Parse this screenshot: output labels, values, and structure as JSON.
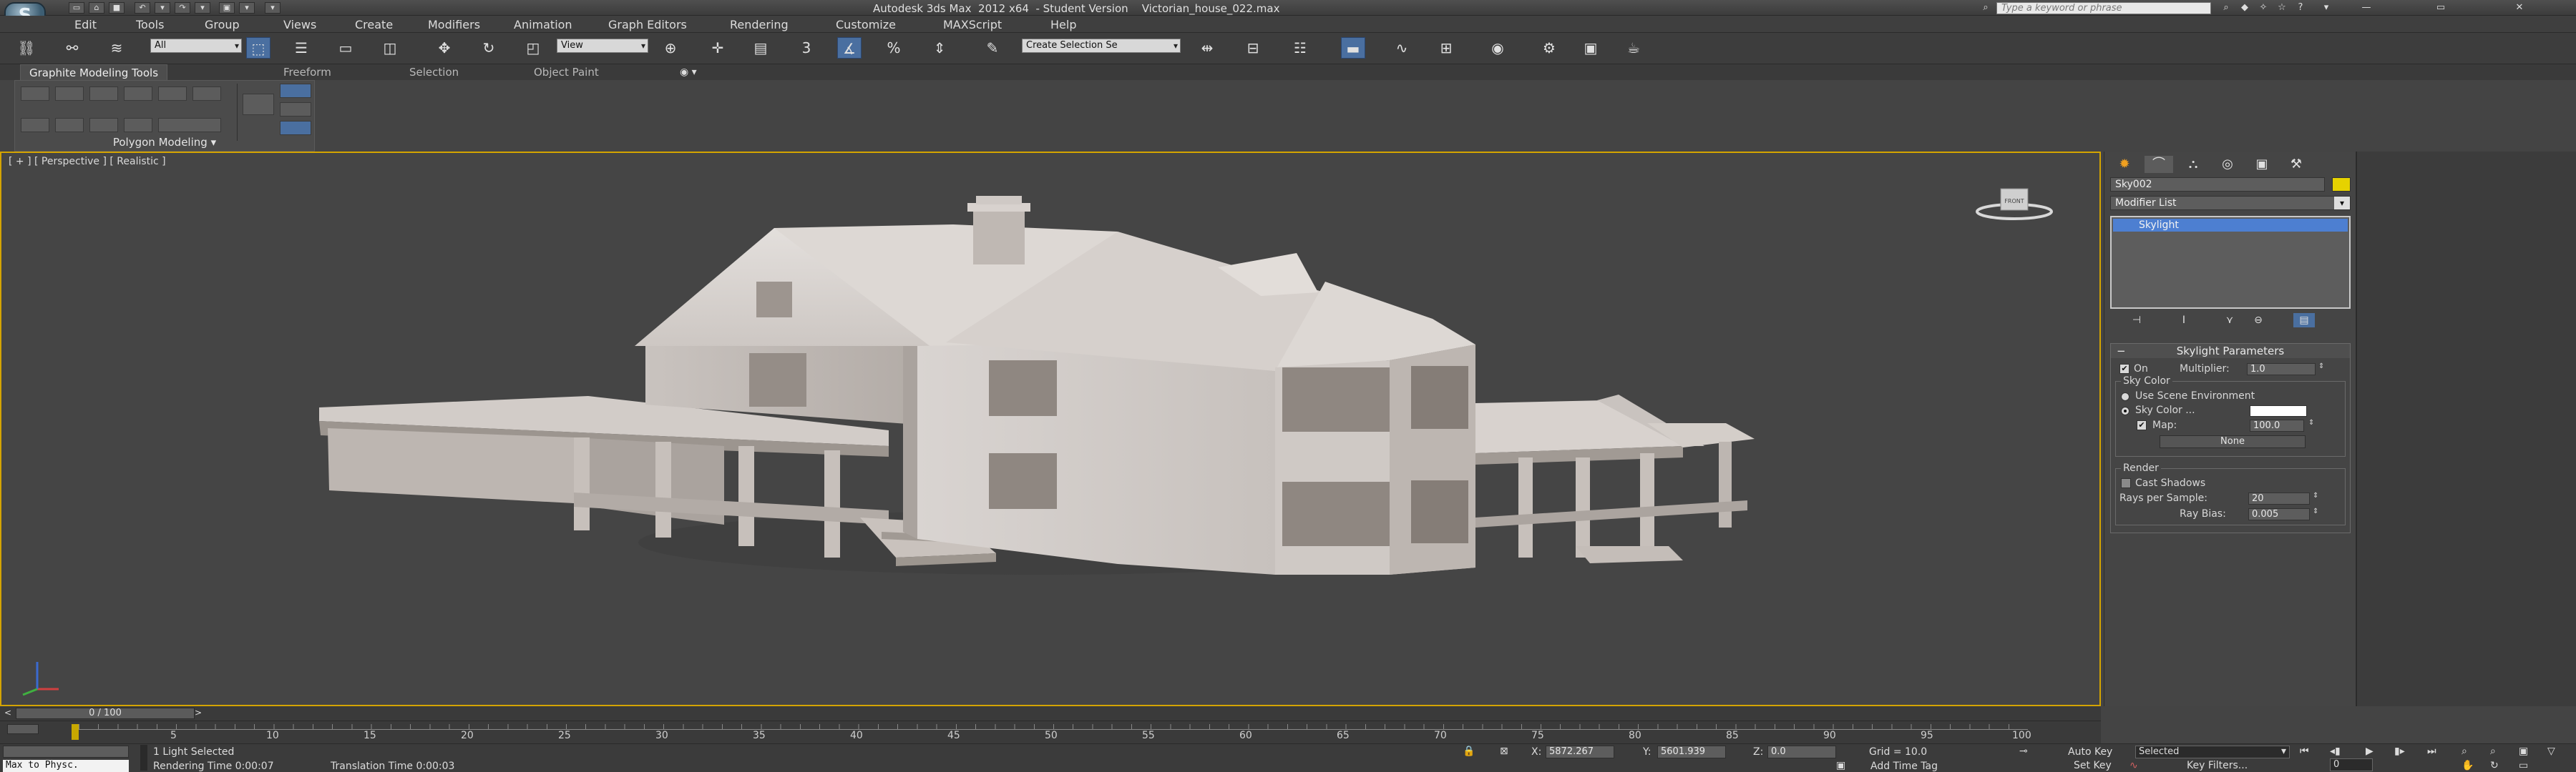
{
  "app": {
    "logo": "S",
    "title": "Autodesk 3ds Max  2012 x64  - Student Version    Victorian_house_022.max",
    "search_placeholder": "Type a keyword or phrase"
  },
  "menu": [
    "Edit",
    "Tools",
    "Group",
    "Views",
    "Create",
    "Modifiers",
    "Animation",
    "Graph Editors",
    "Rendering",
    "Customize",
    "MAXScript",
    "Help"
  ],
  "toolbar": {
    "selection_filter": "All",
    "reference_coord": "View",
    "named_selection": "Create Selection Se"
  },
  "ribbon": {
    "tabs": [
      "Graphite Modeling Tools",
      "Freeform",
      "Selection",
      "Object Paint"
    ],
    "panel_label": "Polygon Modeling"
  },
  "viewport": {
    "label": "[ + ] [ Perspective ] [ Realistic ]",
    "model": "house-model",
    "viewcube_label": "FRONT"
  },
  "command_panel": {
    "object_name": "Sky002",
    "object_color": "#e6d200",
    "modifier_list": "Modifier List",
    "stack": [
      "Skylight"
    ],
    "rollout_title": "Skylight Parameters",
    "on_label": "On",
    "multiplier_label": "Multiplier:",
    "multiplier_value": "1.0",
    "sky_color_group": "Sky Color",
    "use_scene_env": "Use Scene Environment",
    "sky_color_label": "Sky Color ...",
    "map_label": "Map:",
    "map_value": "100.0",
    "map_button": "None",
    "render_group": "Render",
    "cast_shadows": "Cast Shadows",
    "rays_label": "Rays per Sample:",
    "rays_value": "20",
    "ray_bias_label": "Ray Bias:",
    "ray_bias_value": "0.005"
  },
  "timeline": {
    "frame_display": "0 / 100",
    "ticks": [
      "5",
      "10",
      "15",
      "20",
      "25",
      "30",
      "35",
      "40",
      "45",
      "50",
      "55",
      "60",
      "65",
      "70",
      "75",
      "80",
      "85",
      "90",
      "95",
      "100"
    ]
  },
  "status": {
    "maxscript": "Max to Physc.",
    "selection": "1 Light Selected",
    "render_time": "Rendering Time  0:00:07",
    "translation_time": "Translation Time  0:00:03",
    "x_label": "X:",
    "x_value": "5872.267",
    "y_label": "Y:",
    "y_value": "5601.939",
    "z_label": "Z:",
    "z_value": "0.0",
    "grid": "Grid = 10.0",
    "add_time_tag": "Add Time Tag",
    "auto_key": "Auto Key",
    "auto_key_mode": "Selected",
    "set_key": "Set Key",
    "key_filters": "Key Filters...",
    "current_frame": "0"
  }
}
